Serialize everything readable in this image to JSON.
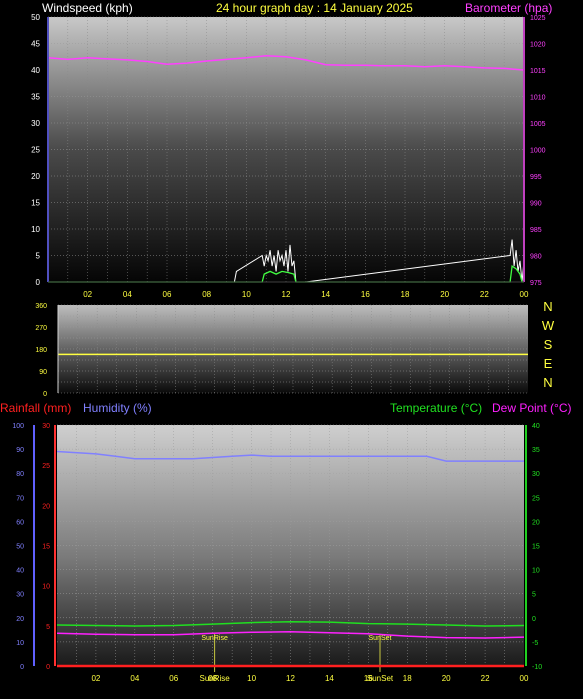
{
  "header": {
    "windspeed_label": "Windspeed (kph)",
    "graph_title": "24 hour graph day : 14 January 2025",
    "barometer_label": "Barometer (hpa)"
  },
  "footer_labels": {
    "rainfall_label": "Rainfall (mm)",
    "humidity_label": "Humidity (%)",
    "temperature_label": "Temperature (°C)",
    "dewpoint_label": "Dew Point (°C)",
    "sunrise_label": "SunRise",
    "sunset_label": "SunSet"
  },
  "colors": {
    "windspeed": "#ffffff",
    "gust": "#c0c0c0",
    "barometer": "#ff40ff",
    "wind_avg": "#40ff40",
    "direction": "#ffff40",
    "rainfall": "#ff2020",
    "humidity": "#8080ff",
    "temperature": "#20e020",
    "dewpoint": "#ff20ff",
    "tick_labels": "#ffff40",
    "left_axis_numbers": "#ffffff"
  },
  "chart_data": [
    {
      "type": "line",
      "name": "wind-barometer",
      "x_ticks": [
        "02",
        "04",
        "06",
        "08",
        "10",
        "12",
        "14",
        "16",
        "18",
        "20",
        "22",
        "00"
      ],
      "y_left_ticks": [
        0,
        5,
        10,
        15,
        20,
        25,
        30,
        35,
        40,
        45,
        50
      ],
      "y_left_range": [
        0,
        50
      ],
      "y_right_ticks": [
        975,
        980,
        985,
        990,
        995,
        1000,
        1005,
        1010,
        1015,
        1020,
        1025
      ],
      "y_right_range": [
        975,
        1025
      ],
      "x_range": [
        0,
        24
      ],
      "series": [
        {
          "key": "barometer",
          "x": [
            0,
            1,
            2,
            3,
            4,
            5,
            6,
            7,
            8,
            9,
            10,
            11,
            12,
            13,
            14,
            15,
            16,
            17,
            18,
            19,
            20,
            21,
            22,
            23,
            24
          ],
          "y": [
            1017.3,
            1017.0,
            1017.3,
            1017.1,
            1016.9,
            1016.6,
            1016.1,
            1016.3,
            1016.7,
            1017.0,
            1017.3,
            1017.7,
            1017.5,
            1016.9,
            1016.0,
            1015.9,
            1015.9,
            1015.8,
            1015.8,
            1015.6,
            1015.8,
            1015.6,
            1015.4,
            1015.3,
            1015.0
          ]
        },
        {
          "key": "windspeed",
          "x": [
            0,
            9.4,
            9.5,
            10.8,
            10.9,
            11.0,
            11.1,
            11.2,
            11.3,
            11.4,
            11.5,
            11.6,
            11.7,
            11.8,
            11.9,
            12.0,
            12.1,
            12.2,
            12.3,
            12.4,
            12.5,
            13,
            23.3,
            23.4,
            23.5,
            23.6,
            23.7,
            23.8,
            23.9,
            24
          ],
          "y": [
            0,
            0,
            2,
            5,
            3,
            5,
            4,
            6,
            3,
            5,
            2,
            6,
            4,
            5,
            3,
            6,
            2,
            7,
            3,
            4,
            0,
            0,
            5,
            8,
            3,
            6,
            2,
            4,
            0,
            4
          ]
        },
        {
          "key": "wind_avg",
          "x": [
            0,
            10.8,
            10.9,
            11.2,
            11.5,
            11.8,
            12.1,
            12.4,
            12.5,
            13,
            23.3,
            23.4,
            23.6,
            23.8,
            23.9,
            24
          ],
          "y": [
            0,
            0,
            1.5,
            2,
            1.5,
            2,
            1.8,
            1.5,
            0,
            0,
            0,
            3,
            2.5,
            1.5,
            0,
            0
          ]
        }
      ]
    },
    {
      "type": "line",
      "name": "wind-direction",
      "x_range": [
        0,
        24
      ],
      "y_ticks": [
        0,
        45,
        90,
        135,
        180,
        225,
        270,
        315,
        360
      ],
      "y_tick_labels": [
        "0",
        "",
        "90",
        "",
        "180",
        "",
        "270",
        "",
        "360"
      ],
      "y_range": [
        0,
        360
      ],
      "compass_labels": [
        "N",
        "W",
        "S",
        "E",
        "N"
      ],
      "series": [
        {
          "key": "direction",
          "x": [
            0,
            24
          ],
          "y": [
            158,
            158
          ]
        }
      ]
    },
    {
      "type": "line",
      "name": "temp-humidity-rain",
      "x_ticks": [
        "02",
        "04",
        "06",
        "08",
        "10",
        "12",
        "14",
        "16",
        "18",
        "20",
        "22",
        "00"
      ],
      "y_left_humidity_ticks": [
        0,
        10,
        20,
        30,
        40,
        50,
        60,
        70,
        80,
        90,
        100
      ],
      "y_left_rain_ticks": [
        0,
        5,
        10,
        15,
        20,
        25,
        30
      ],
      "y_right_temp_ticks": [
        -10,
        -5,
        0,
        5,
        10,
        15,
        20,
        25,
        30,
        35,
        40
      ],
      "humidity_range": [
        0,
        100
      ],
      "rain_range": [
        0,
        30
      ],
      "temp_range": [
        -10,
        40
      ],
      "x_range": [
        0,
        24
      ],
      "sunrise_hour": 8.1,
      "sunset_hour": 16.6,
      "series": [
        {
          "key": "humidity",
          "x": [
            0,
            2,
            3,
            4,
            5,
            6,
            7,
            8,
            9,
            10,
            11,
            12,
            13,
            14,
            15,
            16,
            17,
            18,
            19,
            20,
            21,
            22,
            23,
            24
          ],
          "y": [
            89,
            88,
            87,
            86,
            86,
            86,
            86,
            86.5,
            87,
            87.5,
            87,
            87,
            87,
            87,
            87,
            87,
            87,
            87,
            87,
            85,
            85,
            85,
            85,
            85
          ]
        },
        {
          "key": "temperature",
          "x": [
            0,
            2,
            4,
            6,
            8,
            10,
            12,
            14,
            16,
            18,
            20,
            22,
            24
          ],
          "y": [
            -1.5,
            -1.6,
            -1.7,
            -1.6,
            -1.3,
            -1.0,
            -0.8,
            -0.9,
            -1.2,
            -1.3,
            -1.5,
            -1.7,
            -1.6
          ]
        },
        {
          "key": "dewpoint",
          "x": [
            0,
            2,
            4,
            6,
            8,
            10,
            12,
            14,
            16,
            18,
            20,
            22,
            24
          ],
          "y": [
            -3.2,
            -3.4,
            -3.5,
            -3.5,
            -3.2,
            -3.0,
            -2.9,
            -3.1,
            -3.3,
            -3.8,
            -4.1,
            -4.2,
            -4.0
          ]
        },
        {
          "key": "rainfall",
          "x": [
            0,
            24
          ],
          "y": [
            0,
            0
          ]
        }
      ]
    }
  ]
}
